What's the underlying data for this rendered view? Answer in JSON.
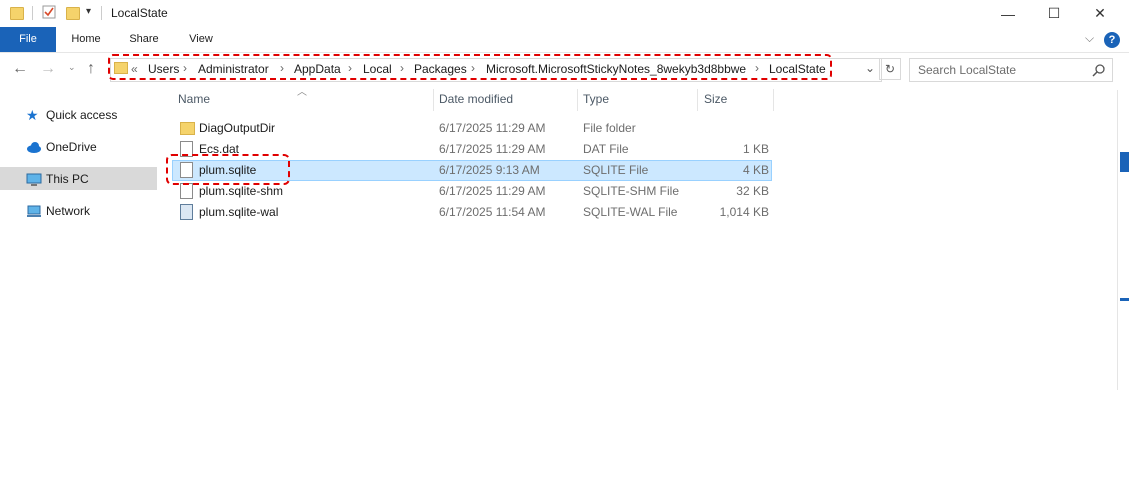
{
  "window": {
    "title": "LocalState",
    "minimize": "—",
    "maximize": "☐",
    "close": "✕"
  },
  "ribbon": {
    "tabs": [
      "File",
      "Home",
      "Share",
      "View"
    ],
    "expand_icon": "chevron-down-icon",
    "help_icon": "help-icon"
  },
  "address": {
    "overflow": "«",
    "crumbs": [
      "Users",
      "Administrator",
      "AppData",
      "Local",
      "Packages",
      "Microsoft.MicrosoftStickyNotes_8wekyb3d8bbwe",
      "LocalState"
    ],
    "separator": "›"
  },
  "search": {
    "placeholder": "Search LocalState"
  },
  "nav": {
    "items": [
      {
        "label": "Quick access",
        "icon": "star-icon"
      },
      {
        "label": "OneDrive",
        "icon": "cloud-icon"
      },
      {
        "label": "This PC",
        "icon": "computer-icon",
        "selected": true
      },
      {
        "label": "Network",
        "icon": "network-icon"
      }
    ]
  },
  "list": {
    "columns": [
      "Name",
      "Date modified",
      "Type",
      "Size"
    ],
    "rows": [
      {
        "name": "DiagOutputDir",
        "date": "6/17/2025 11:29 AM",
        "type": "File folder",
        "size": "",
        "icon": "folder-icon"
      },
      {
        "name": "Ecs.dat",
        "date": "6/17/2025 11:29 AM",
        "type": "DAT File",
        "size": "1 KB",
        "icon": "file-icon"
      },
      {
        "name": "plum.sqlite",
        "date": "6/17/2025 9:13 AM",
        "type": "SQLITE File",
        "size": "4 KB",
        "icon": "file-icon",
        "selected": true
      },
      {
        "name": "plum.sqlite-shm",
        "date": "6/17/2025 11:29 AM",
        "type": "SQLITE-SHM File",
        "size": "32 KB",
        "icon": "file-icon"
      },
      {
        "name": "plum.sqlite-wal",
        "date": "6/17/2025 11:54 AM",
        "type": "SQLITE-WAL File",
        "size": "1,014 KB",
        "icon": "wal-file-icon"
      }
    ]
  },
  "colors": {
    "accent": "#1a63b8",
    "selection": "#cce8ff",
    "highlight": "#e00000"
  }
}
